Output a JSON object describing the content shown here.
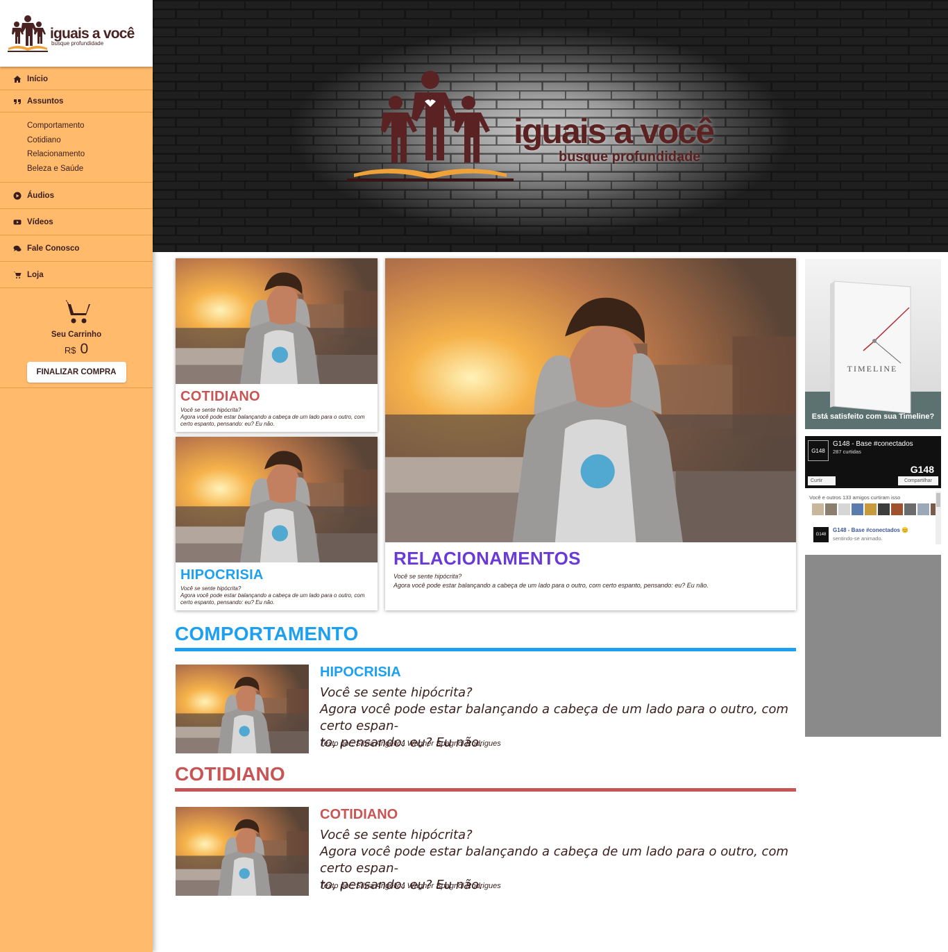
{
  "brand": {
    "title": "iguais a você",
    "subtitle": "busque profundidade"
  },
  "nav": {
    "items": [
      {
        "label": "Início",
        "icon": "home-icon"
      },
      {
        "label": "Assuntos",
        "icon": "quote-icon"
      },
      {
        "label": "Áudios",
        "icon": "play-circle-icon"
      },
      {
        "label": "Vídeos",
        "icon": "youtube-play-icon"
      },
      {
        "label": "Fale Conosco",
        "icon": "comments-icon"
      },
      {
        "label": "Loja",
        "icon": "shopping-cart-icon"
      }
    ],
    "subitems": [
      "Comportamento",
      "Cotidiano",
      "Relacionamento",
      "Beleza e Saúde"
    ]
  },
  "cart": {
    "label": "Seu Carrinho",
    "currency": "R$",
    "total": "0",
    "checkout_label": "FINALIZAR COMPRA"
  },
  "featured": [
    {
      "title": "COTIDIANO",
      "color": "#c85554",
      "text_line1": "Você se sente hipócrita?",
      "text_line2": "Agora você pode estar balançando a cabeça de um lado para o outro, com certo espanto, pensando: eu? Eu não."
    },
    {
      "title": "HIPOCRISIA",
      "color": "#1ea0f0",
      "text_line1": "Você se sente hipócrita?",
      "text_line2": "Agora você pode estar balançando a cabeça de um lado para o outro, com certo espanto, pensando: eu? Eu não."
    },
    {
      "title": "RELACIONAMENTOS",
      "color": "#6a3ad8",
      "text_line1": "Você se sente hipócrita?",
      "text_line2": "Agora você pode estar balançando a cabeça de um lado para o outro, com certo espanto, pensando: eu? Eu não."
    }
  ],
  "sections": [
    {
      "title": "COMPORTAMENTO",
      "color": "#1ea0f0",
      "post": {
        "title": "HIPOCRISIA",
        "text_line1": "Você se sente hipócrita?",
        "text_line2": "Agora você pode estar balançando a cabeça de um lado para o outro, com certo espan-",
        "text_line3": "to, pensando: eu? Eu não.",
        "author": "Texto por: Silvia Angélica Wagner Spagnol Rodrigues"
      }
    },
    {
      "title": "COTIDIANO",
      "color": "#c85554",
      "post": {
        "title": "COTIDIANO",
        "text_line1": "Você se sente hipócrita?",
        "text_line2": "Agora você pode estar balançando a cabeça de um lado para o outro, com certo espan-",
        "text_line3": "to, pensando: eu? Eu não.",
        "author": "Texto por: Silvia Angélica Wagner Spagnol Rodrigues"
      }
    }
  ],
  "ad": {
    "caption": "Está satisfeito com sua Timeline?",
    "book_title": "TIMELINE"
  },
  "facebook": {
    "page_name": "G148 - Base #conectados",
    "likes": "287 curtidas",
    "like_button": "Curtir",
    "share_button": "Compartilhar",
    "friends_text": "Você e outros 133 amigos curtiram isso",
    "post_name": "G148 - Base #conectados 😊",
    "post_sub": "sentindo-se animado.",
    "logo_text": "G148"
  }
}
